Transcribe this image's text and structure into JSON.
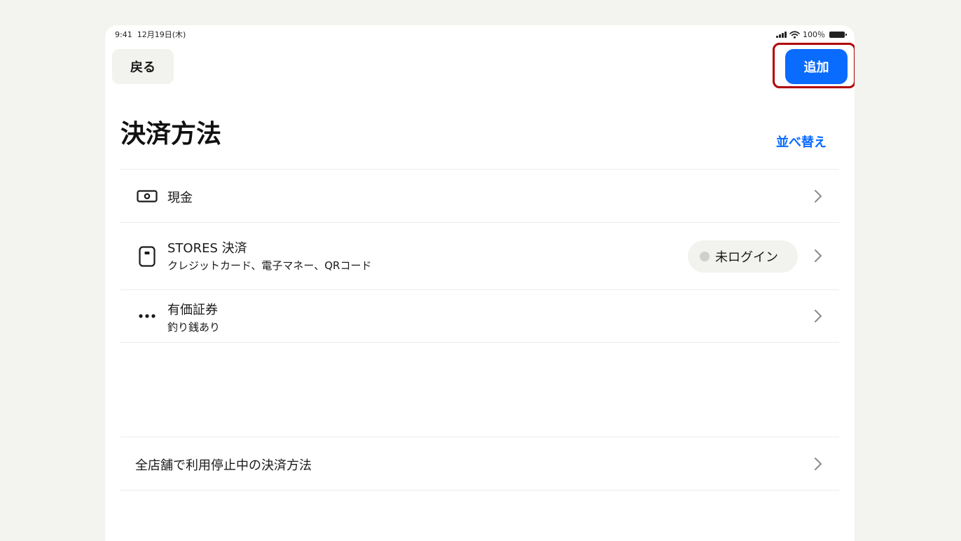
{
  "status_bar": {
    "time": "9:41",
    "date": "12月19日(木)",
    "battery_percent": "100％"
  },
  "header": {
    "back_label": "戻る",
    "add_label": "追加"
  },
  "title": "決済方法",
  "sort_label": "並べ替え",
  "payment_methods": [
    {
      "icon": "cash-icon",
      "title": "現金",
      "subtitle": ""
    },
    {
      "icon": "card-reader-icon",
      "title": "STORES 決済",
      "subtitle": "クレジットカード、電子マネー、QRコード",
      "badge": "未ログイン"
    },
    {
      "icon": "more-dots-icon",
      "title": "有価証券",
      "subtitle": "釣り銭あり"
    }
  ],
  "suspended_link": "全店舗で利用停止中の決済方法",
  "colors": {
    "accent": "#0a6bff",
    "highlight_border": "#b00000",
    "background": "#f3f3ef"
  }
}
